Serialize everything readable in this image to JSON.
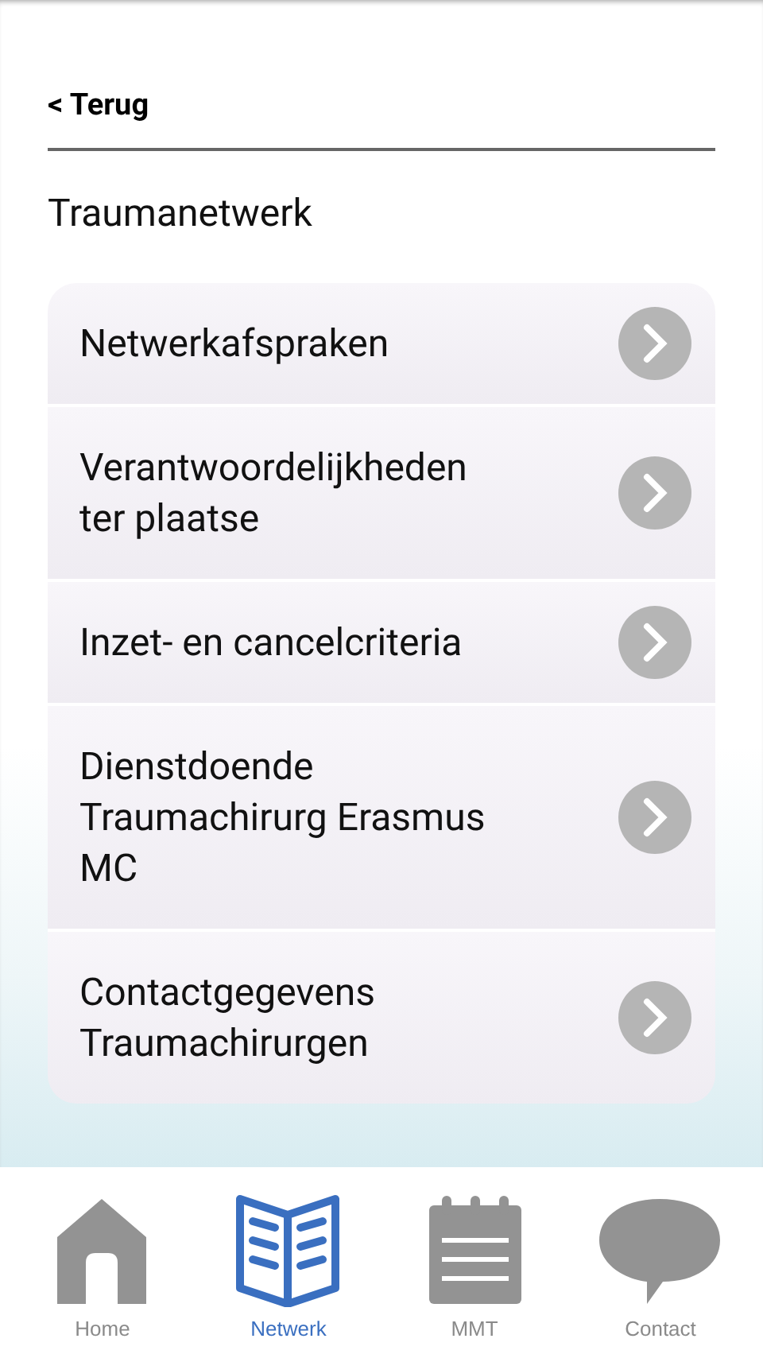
{
  "back_link": "< Terug",
  "title": "Traumanetwerk",
  "menu_items": [
    {
      "label": "Netwerkafspraken"
    },
    {
      "label": "Verantwoordelijkheden ter plaatse"
    },
    {
      "label": "Inzet- en cancelcriteria"
    },
    {
      "label": "Dienstdoende Traumachirurg Erasmus MC"
    },
    {
      "label": "Contactgegevens Traumachirurgen"
    }
  ],
  "tab_bar": [
    {
      "kind": "home",
      "label": "Home",
      "selected": false
    },
    {
      "kind": "book",
      "label": "Netwerk",
      "selected": true
    },
    {
      "kind": "notepad",
      "label": "MMT",
      "selected": false
    },
    {
      "kind": "chat",
      "label": "Contact",
      "selected": false
    }
  ]
}
